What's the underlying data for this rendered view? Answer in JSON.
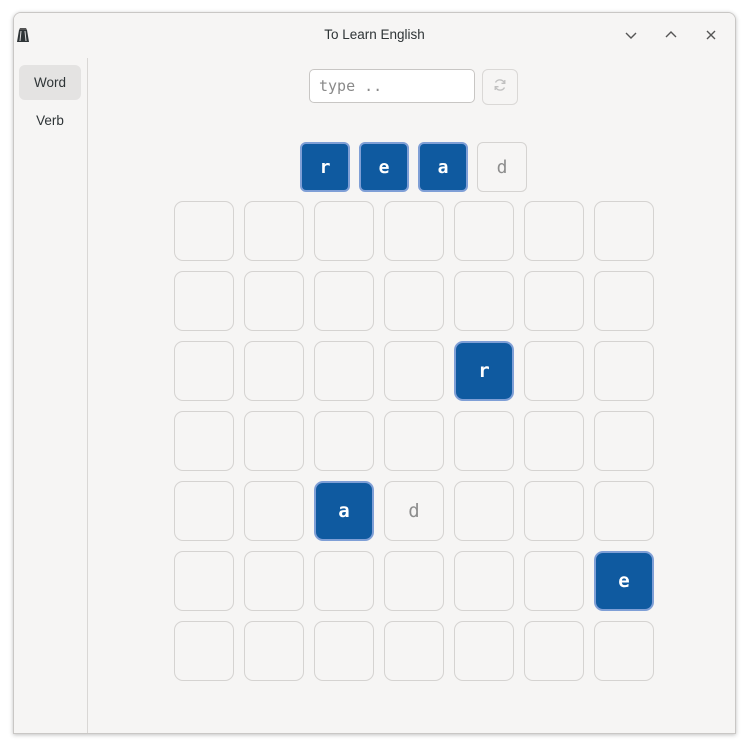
{
  "window": {
    "title": "To Learn English"
  },
  "sidebar": {
    "items": [
      {
        "label": "Word",
        "active": true
      },
      {
        "label": "Verb",
        "active": false
      }
    ]
  },
  "input": {
    "value": "",
    "placeholder": "type .."
  },
  "word_tiles": [
    {
      "letter": "r",
      "state": "filled"
    },
    {
      "letter": "e",
      "state": "filled"
    },
    {
      "letter": "a",
      "state": "filled"
    },
    {
      "letter": "d",
      "state": "hint"
    }
  ],
  "grid": {
    "rows": 7,
    "cols": 7,
    "cells": [
      {
        "row": 2,
        "col": 4,
        "letter": "r",
        "state": "filled"
      },
      {
        "row": 4,
        "col": 2,
        "letter": "a",
        "state": "filled"
      },
      {
        "row": 4,
        "col": 3,
        "letter": "d",
        "state": "hint"
      },
      {
        "row": 5,
        "col": 6,
        "letter": "e",
        "state": "filled"
      }
    ]
  },
  "colors": {
    "tile_fill": "#0f5aa0",
    "tile_border": "#7f9fd6",
    "hint_text": "#8d8d8d"
  },
  "icons": {
    "app": "app-icon",
    "minimize": "chevron-down-icon",
    "maximize": "chevron-up-icon",
    "close": "close-icon",
    "refresh": "refresh-icon"
  }
}
